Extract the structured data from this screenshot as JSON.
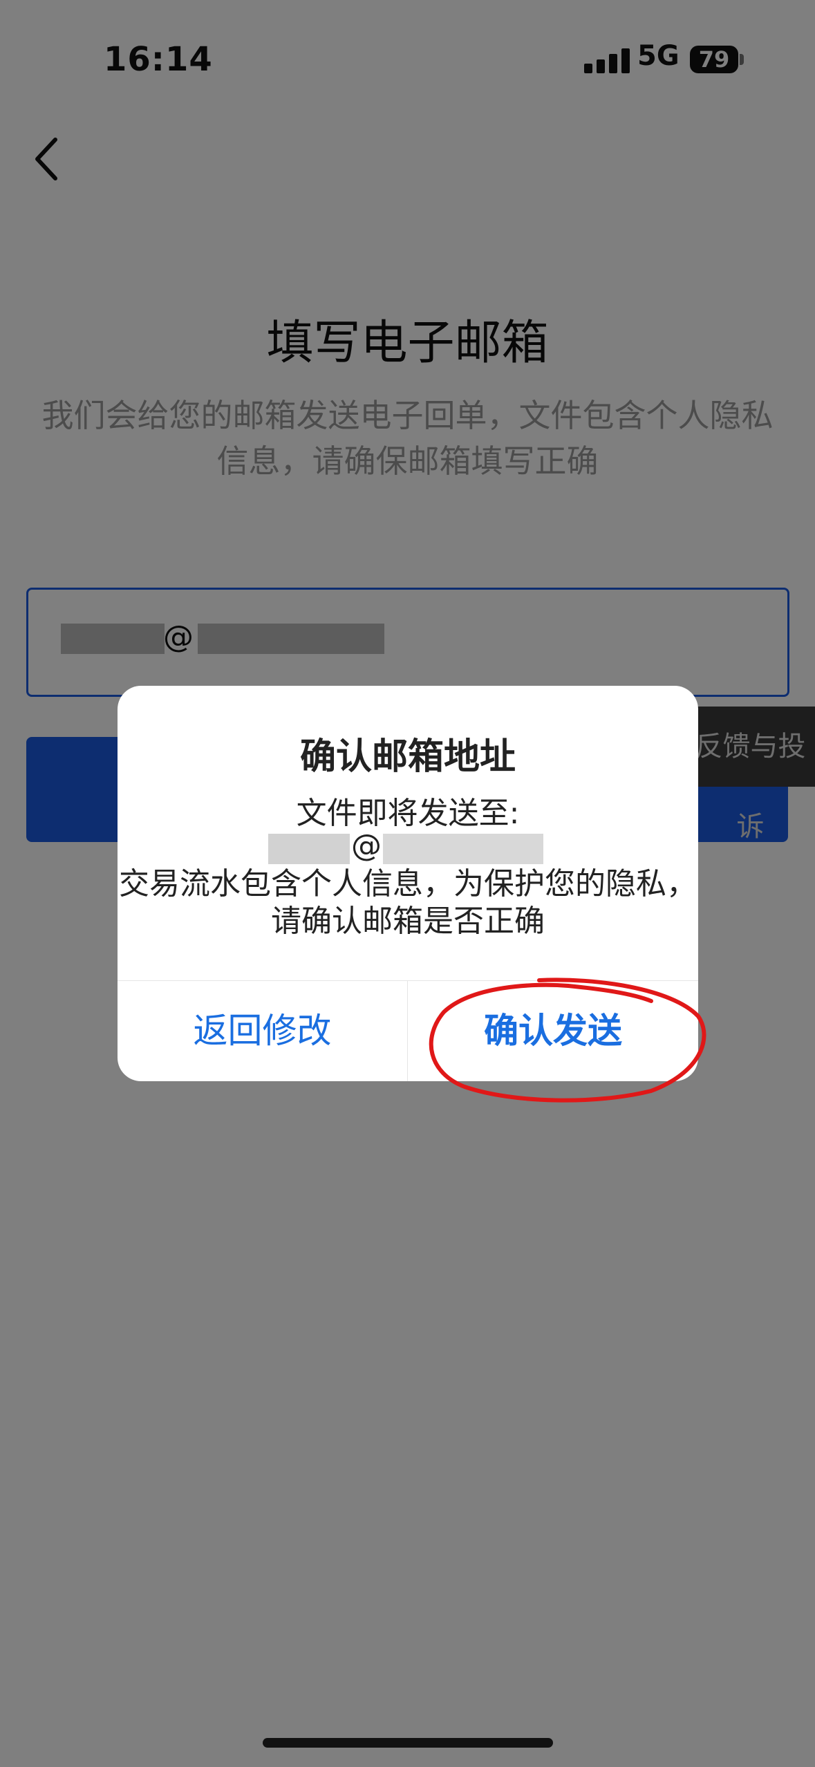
{
  "status_bar": {
    "time": "16:14",
    "network": "5G",
    "battery": "79"
  },
  "page": {
    "title": "填写电子邮箱",
    "subtitle": "我们会给您的邮箱发送电子回单，文件包含个人隐私信息，请确保邮箱填写正确",
    "email_input": {
      "at_symbol": "@"
    },
    "feedback_tab": "反馈与投诉"
  },
  "dialog": {
    "title": "确认邮箱地址",
    "line1": "文件即将发送至:",
    "at_symbol": "@",
    "line2": "交易流水包含个人信息，为保护您的隐私，请确认邮箱是否正确",
    "cancel_label": "返回修改",
    "confirm_label": "确认发送"
  },
  "colors": {
    "accent": "#1a5ae0",
    "dialog_button": "#1a6ee0",
    "annotation": "#e01818"
  },
  "icons": {
    "back": "chevron-left-icon",
    "signal": "signal-bars-icon",
    "battery": "battery-icon"
  }
}
